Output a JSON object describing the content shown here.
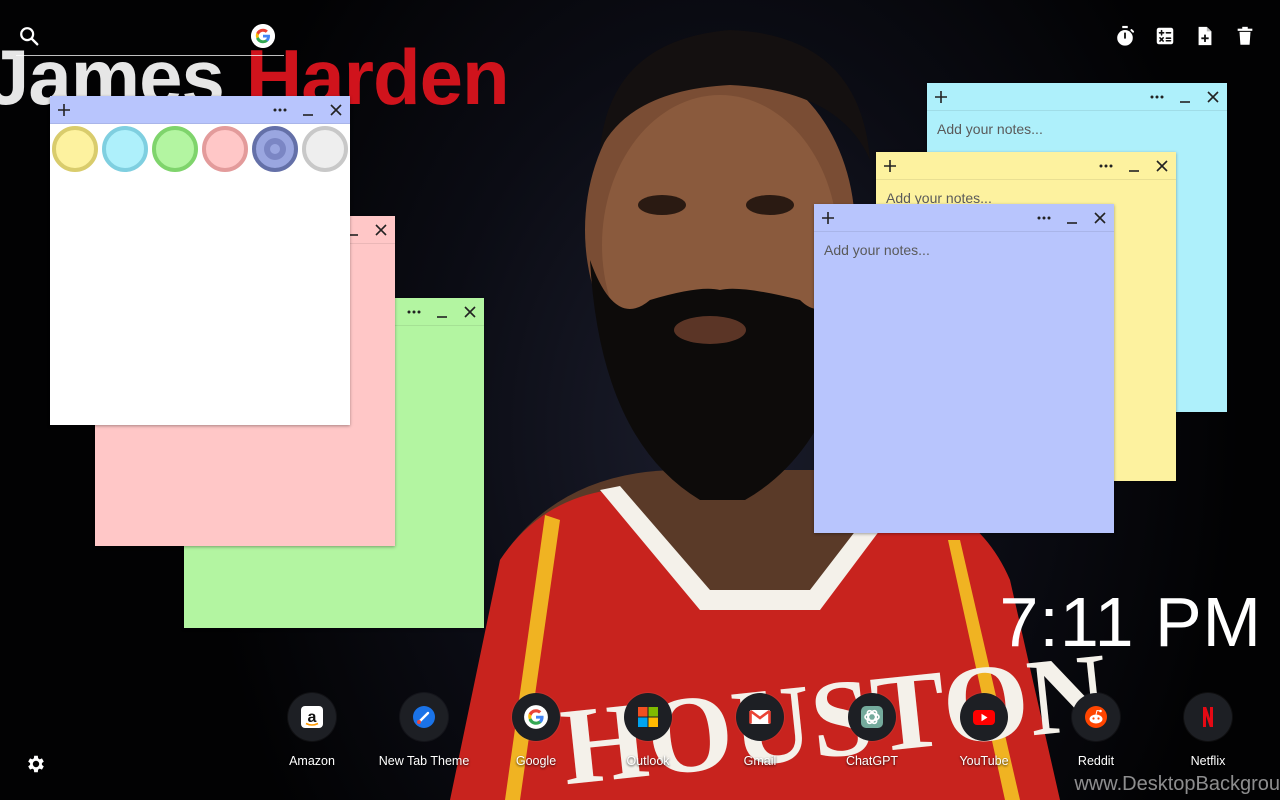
{
  "background": {
    "first_name": "James",
    "last_name": "Harden",
    "watermark": "www.DesktopBackgrou",
    "jersey_text": "HOUSTON"
  },
  "search": {
    "placeholder": "",
    "value": "",
    "engine_icon": "google-icon"
  },
  "toolbar": {
    "icons": [
      "timer-icon",
      "calculator-icon",
      "add-note-icon",
      "trash-icon"
    ]
  },
  "note_controls": {
    "add": "+",
    "more": "•••",
    "minimize": "_",
    "close": "×"
  },
  "notes": [
    {
      "color": "#b3f5a1",
      "placeholder": ""
    },
    {
      "color": "#ffc7c7",
      "placeholder": ""
    },
    {
      "color": "#ffffff",
      "placeholder": ""
    },
    {
      "color": "#aef0fb",
      "placeholder": "Add your notes..."
    },
    {
      "color": "#fdf29f",
      "placeholder": "Add your notes..."
    },
    {
      "color": "#b8c5fd",
      "placeholder": "Add your notes..."
    }
  ],
  "color_swatches": [
    {
      "name": "yellow",
      "fill": "#fdf29f",
      "ring": "#d9cc6c"
    },
    {
      "name": "cyan",
      "fill": "#aef0fb",
      "ring": "#7fcfe0"
    },
    {
      "name": "green",
      "fill": "#b3f5a1",
      "ring": "#7fd46c"
    },
    {
      "name": "pink",
      "fill": "#ffc7c7",
      "ring": "#e39b9b"
    },
    {
      "name": "lavender",
      "fill": "#9aa6e0",
      "ring": "#6470a8",
      "selected": true
    },
    {
      "name": "gray",
      "fill": "#eeeeee",
      "ring": "#c8c8c8"
    }
  ],
  "clock": {
    "time": "7:11 PM"
  },
  "shortcuts": [
    {
      "label": "Amazon",
      "icon": "amazon-icon"
    },
    {
      "label": "New Tab Theme",
      "icon": "new-tab-theme-icon"
    },
    {
      "label": "Google",
      "icon": "google-icon"
    },
    {
      "label": "Outlook",
      "icon": "outlook-icon"
    },
    {
      "label": "Gmail",
      "icon": "gmail-icon"
    },
    {
      "label": "ChatGPT",
      "icon": "chatgpt-icon"
    },
    {
      "label": "YouTube",
      "icon": "youtube-icon"
    },
    {
      "label": "Reddit",
      "icon": "reddit-icon"
    },
    {
      "label": "Netflix",
      "icon": "netflix-icon"
    }
  ],
  "settings": {
    "icon": "gear-icon"
  }
}
